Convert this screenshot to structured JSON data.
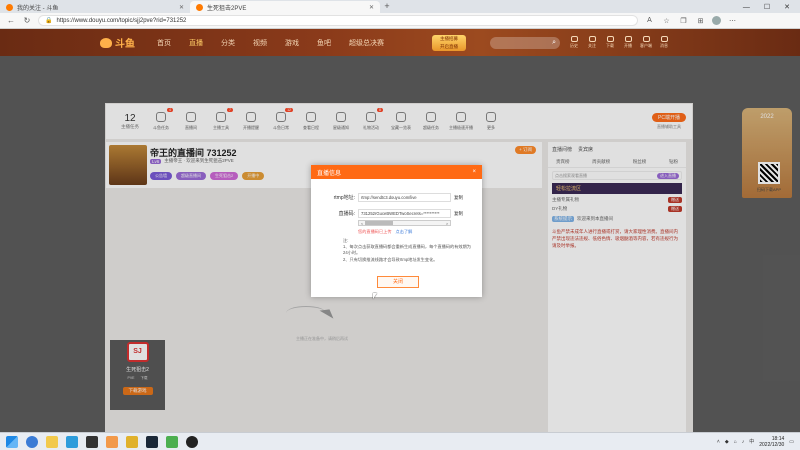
{
  "browser": {
    "tabs": [
      {
        "label": "我的关注 - 斗鱼",
        "active": false
      },
      {
        "label": "生死狙击2PVE",
        "active": true
      }
    ],
    "url": "https://www.douyu.com/topic/sjj2pve?rid=731252"
  },
  "site": {
    "logo": "斗鱼",
    "nav": [
      "首页",
      "直播",
      "分类",
      "视频",
      "游戏",
      "鱼吧",
      "超级总决赛"
    ],
    "promo_line1": "主播招募",
    "promo_line2": "开启直播",
    "header_icons": [
      "历史",
      "关注",
      "下载",
      "开播",
      "客户端",
      "消息"
    ]
  },
  "toolbar": {
    "count_num": "12",
    "count_label": "主播任务",
    "items": [
      {
        "label": "斗鱼任务",
        "badge": "4"
      },
      {
        "label": "直播间",
        "badge": ""
      },
      {
        "label": "主播工具",
        "badge": "7"
      },
      {
        "label": "开播提醒",
        "badge": ""
      },
      {
        "label": "斗鱼日常",
        "badge": "12"
      },
      {
        "label": "查看日程",
        "badge": ""
      },
      {
        "label": "星级通知",
        "badge": ""
      },
      {
        "label": "礼物活动",
        "badge": "8"
      },
      {
        "label": "宝藏一览表",
        "badge": ""
      },
      {
        "label": "超级任务",
        "badge": ""
      },
      {
        "label": "主播极速开播",
        "badge": ""
      },
      {
        "label": "更多",
        "badge": ""
      }
    ],
    "pc_btn": "PC端开播",
    "pc_sub": "直播辅助工具"
  },
  "room": {
    "title": "帝王的直播间 731252",
    "level": "Lv6",
    "sub": "主播帝王  ·  欢迎来到生死狙击2PVE",
    "tags": [
      {
        "label": "公告墙",
        "color": "#7a5ad8"
      },
      {
        "label": "超级直播间",
        "color": "#9b6cd8"
      },
      {
        "label": "生死狙击2",
        "color": "#d06ad8"
      },
      {
        "label": "开播中",
        "color": "#e8a03a"
      }
    ],
    "like": "+ 订阅"
  },
  "video": {
    "hint": "主播正在准备中，请稍后再试"
  },
  "rpanel": {
    "tabs": [
      "直播间榜",
      "贵宾席"
    ],
    "tabs2": [
      "贵宾榜",
      "周贡献榜",
      "粉丝榜",
      "钻粉"
    ],
    "search_placeholder": "点击搜索观看直播",
    "search_btn": "进入直播",
    "section": "轻松拉流区",
    "rows": [
      {
        "label": "主播专属礼物",
        "btn": "赠送"
      },
      {
        "label": "DY礼物",
        "btn": "赠送"
      }
    ],
    "welcome_badge": "系统提示",
    "welcome": "欢迎来到本直播间",
    "chat": "斗鱼严禁未成年人进行直播或打赏，请大家理性消费。直播间内严禁出现违法违规、低俗色情、吸烟酗酒等内容，若有违规行为请及时举报。"
  },
  "left_card": {
    "logo": "SJ",
    "name": "生死狙击2",
    "stat1": "PVE",
    "stat2": "下载",
    "download": "下载游戏"
  },
  "deco": {
    "year": "2022",
    "qr_text": "扫码下载APP"
  },
  "modal": {
    "title": "直播信息",
    "close": "×",
    "rtmp_label": "rtmp地址:",
    "rtmp_value": "rtmp://sendtc3.douyu.com/live",
    "copy": "复制",
    "code_label": "直播码:",
    "code_value": "731252rGuceBWEDTwoSecrets=**********",
    "progress_left": "<",
    "progress_right": ">",
    "progress": 0.35,
    "warn": "您的直播码已上传",
    "warn_link": "点击了解",
    "notes": [
      "注:",
      "1、每次点击获取直播码都会重新生成直播码，每个直播码的有效期为24小时。",
      "2、只有切换推流线路才会导致rtmp地址发生变化。"
    ],
    "close_btn": "关闭"
  },
  "taskbar": {
    "time": "18:14",
    "date": "2022/12/30",
    "tray": "中"
  }
}
